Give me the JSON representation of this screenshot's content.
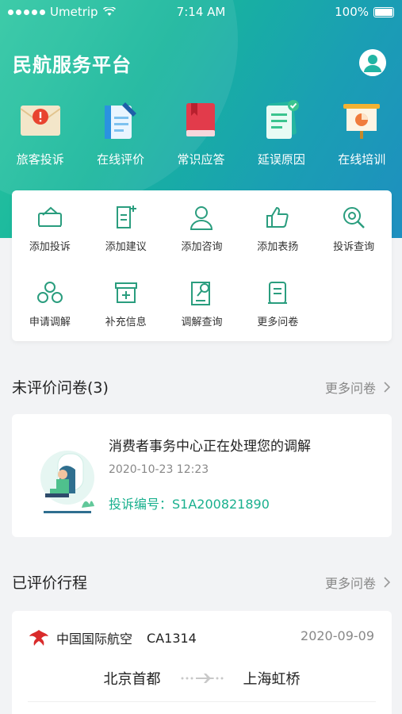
{
  "status_bar": {
    "carrier": "Umetrip",
    "time": "7:14 AM",
    "battery": "100%"
  },
  "header": {
    "title": "民航服务平台"
  },
  "top_menu": [
    {
      "label": "旅客投诉",
      "icon": "complaint-envelope-icon"
    },
    {
      "label": "在线评价",
      "icon": "evaluation-notebook-icon"
    },
    {
      "label": "常识应答",
      "icon": "knowledge-book-icon"
    },
    {
      "label": "延误原因",
      "icon": "delay-document-icon"
    },
    {
      "label": "在线培训",
      "icon": "training-board-icon"
    }
  ],
  "quick_actions": [
    {
      "label": "添加投诉",
      "icon": "add-complaint-icon"
    },
    {
      "label": "添加建议",
      "icon": "add-suggestion-icon"
    },
    {
      "label": "添加咨询",
      "icon": "add-consult-icon"
    },
    {
      "label": "添加表扬",
      "icon": "thumbs-up-icon"
    },
    {
      "label": "投诉查询",
      "icon": "complaint-search-icon"
    },
    {
      "label": "申请调解",
      "icon": "mediation-icon"
    },
    {
      "label": "补充信息",
      "icon": "supplement-box-icon"
    },
    {
      "label": "调解查询",
      "icon": "mediation-search-icon"
    },
    {
      "label": "更多问卷",
      "icon": "more-survey-icon"
    }
  ],
  "unrated_section": {
    "title": "未评价问卷(3)",
    "more": "更多问卷"
  },
  "survey_card": {
    "title": "消费者事务中心正在处理您的调解",
    "datetime": "2020-10-23 12:23",
    "complaint_no": "投诉编号：S1A200821890"
  },
  "rated_section": {
    "title": "已评价行程",
    "more": "更多问卷"
  },
  "trip_card": {
    "airline": "中国国际航空",
    "flight": "CA1314",
    "date": "2020-09-09",
    "from": "北京首都",
    "to": "上海虹桥"
  },
  "colors": {
    "accent": "#19b08e",
    "hero_start": "#2ec7a2",
    "hero_end": "#1e8fc0"
  }
}
